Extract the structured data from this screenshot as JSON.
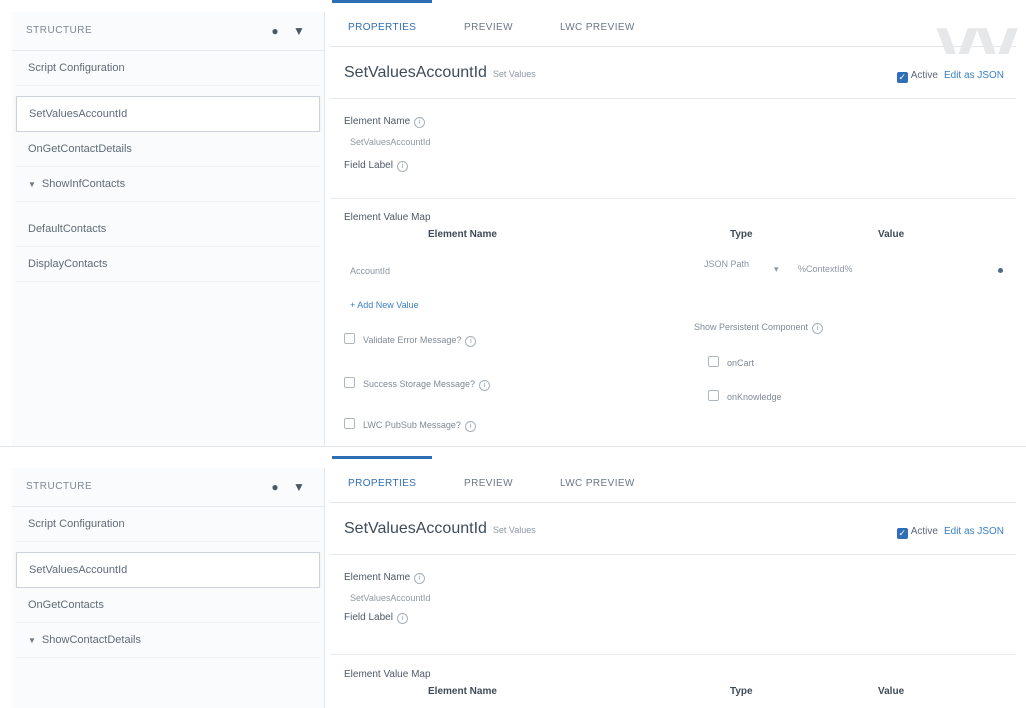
{
  "panel_top": {
    "sidebar": {
      "title": "STRUCTURE",
      "items": [
        {
          "label": "Script Configuration"
        },
        {
          "label": "SetValuesAccountId"
        },
        {
          "label": "OnGetContactDetails"
        },
        {
          "label": "ShowInfContacts",
          "caret": "▼"
        },
        {
          "label": "DefaultContacts"
        },
        {
          "label": "DisplayContacts"
        }
      ]
    },
    "tabs": [
      "PROPERTIES",
      "PREVIEW",
      "LWC PREVIEW"
    ],
    "element": {
      "title": "SetValuesAccountId",
      "subtitle": "Set Values",
      "active_label": "Active",
      "active_checked": true,
      "link": "Edit as JSON",
      "name_label": "Element Name",
      "name_value": "SetValuesAccountId",
      "field_label": "Field Label",
      "map_label": "Element Value Map",
      "columns": [
        "Element Name",
        "Type",
        "Value"
      ],
      "row": {
        "name": "AccountId",
        "type": "JSON Path",
        "value": "%ContextId%"
      },
      "add_link": "+ Add New Value",
      "options": [
        "Validate Error Message?",
        "Success Storage Message?",
        "LWC PubSub Message?"
      ],
      "persistent_label": "Show Persistent Component",
      "persistent_options": [
        "onCart",
        "onKnowledge"
      ]
    },
    "watermark": "VV"
  },
  "panel_bottom": {
    "sidebar": {
      "title": "STRUCTURE",
      "items": [
        {
          "label": "Script Configuration"
        },
        {
          "label": "SetValuesAccountId"
        },
        {
          "label": "OnGetContacts"
        },
        {
          "label": "ShowContactDetails",
          "caret": "▼"
        }
      ]
    },
    "tabs": [
      "PROPERTIES",
      "PREVIEW",
      "LWC PREVIEW"
    ],
    "element": {
      "title": "SetValuesAccountId",
      "subtitle": "Set Values",
      "active_label": "Active",
      "active_checked": true,
      "link": "Edit as JSON",
      "name_label": "Element Name",
      "name_value": "SetValuesAccountId",
      "field_label": "Field Label",
      "map_label": "Element Value Map",
      "columns": [
        "Element Name",
        "Type",
        "Value"
      ]
    }
  },
  "icons": {
    "add": "add-icon",
    "filter": "filter-icon",
    "info": "info-icon"
  },
  "colors": {
    "accent": "#2f6db5",
    "text": "#3d4a57"
  }
}
